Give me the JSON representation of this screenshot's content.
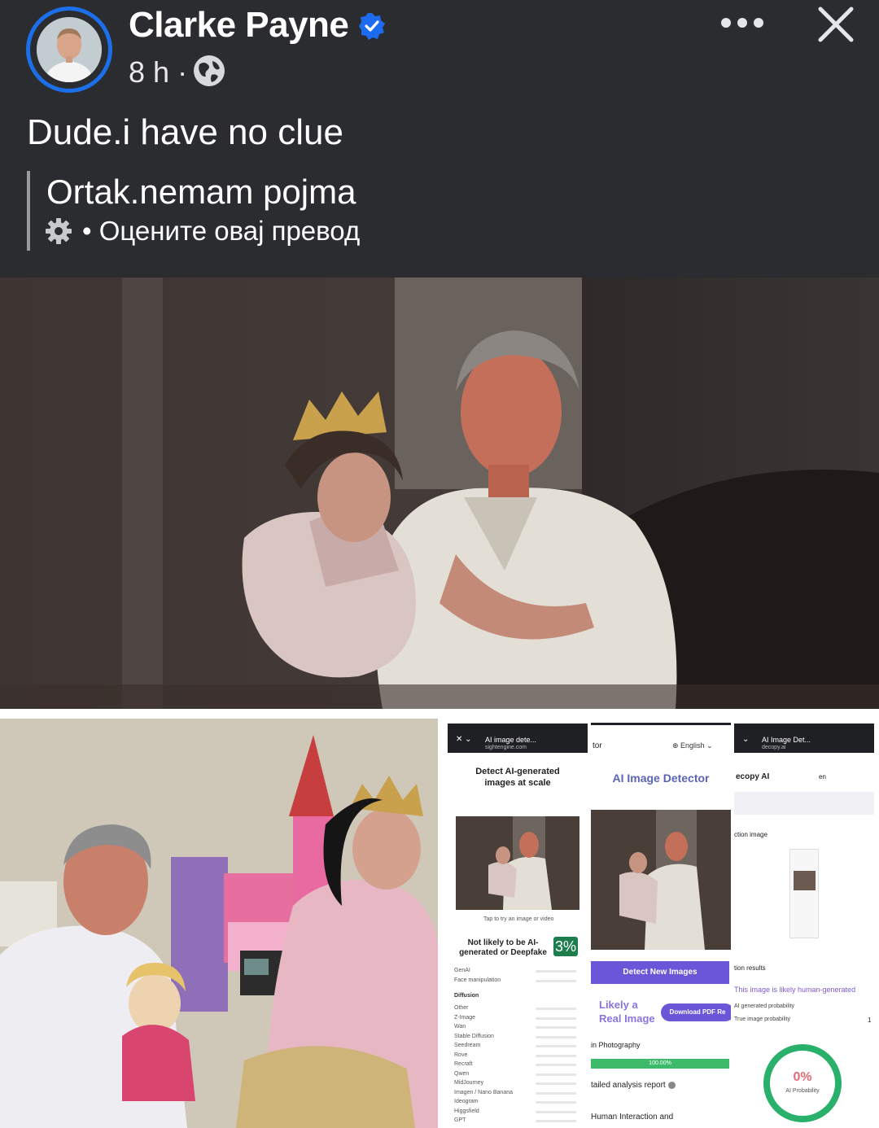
{
  "post": {
    "author": "Clarke Payne",
    "time": "8 h",
    "separator": "·",
    "text": "Dude.i have no clue",
    "translation": {
      "text": "Ortak.nemam pojma",
      "rate_prefix": "•",
      "rate_label": "Оцените овај превод"
    }
  },
  "icons": {
    "verified": "verified-badge-icon",
    "privacy": "globe-icon",
    "more": "more-dots-icon",
    "close": "close-icon",
    "settings": "gear-icon"
  },
  "colors": {
    "background": "#2b2c2f",
    "accent": "#1c6fe8",
    "verified": "#1d6cf0"
  },
  "collage": {
    "pane1": {
      "site_title": "AI image dete...",
      "site_url": "sightengine.com",
      "heading": "Detect AI-generated images at scale",
      "tap_hint": "Tap to try an image or video",
      "result_label": "Not likely to be AI-generated or Deepfake",
      "result_pct": "3%",
      "rows": [
        "GenAI",
        "Face manipulation"
      ],
      "section": "Diffusion",
      "models": [
        "Other",
        "Z-Image",
        "Wan",
        "Stable Diffusion",
        "Seedream",
        "Rove",
        "Recraft",
        "Qwen",
        "MidJourney",
        "Imagen / Nano Banana",
        "Ideogram",
        "Higgsfield",
        "GPT"
      ]
    },
    "pane2": {
      "tab_fragment": "tor",
      "language": "English",
      "heading": "AI Image Detector",
      "button": "Detect New Images",
      "verdict_line1": "Likely a",
      "verdict_line2": "Real Image",
      "download": "Download PDF Re",
      "category": "in Photography",
      "progress_label": "100.00%",
      "progress": 1.0,
      "detail_label": "tailed analysis report",
      "footer_label": "Human Interaction and"
    },
    "pane3": {
      "site_title": "AI Image Det...",
      "site_url": "decopy.ai",
      "brand": "ecopy AI",
      "lang": "en",
      "section1": "ction image",
      "section2": "tion results",
      "result_text": "This image is likely human-generated",
      "ai_prob_label": "AI generated probability",
      "true_prob_label": "True image probability",
      "true_prob_value": "1",
      "ring_pct": "0%",
      "ring_label": "AI Probability"
    }
  }
}
